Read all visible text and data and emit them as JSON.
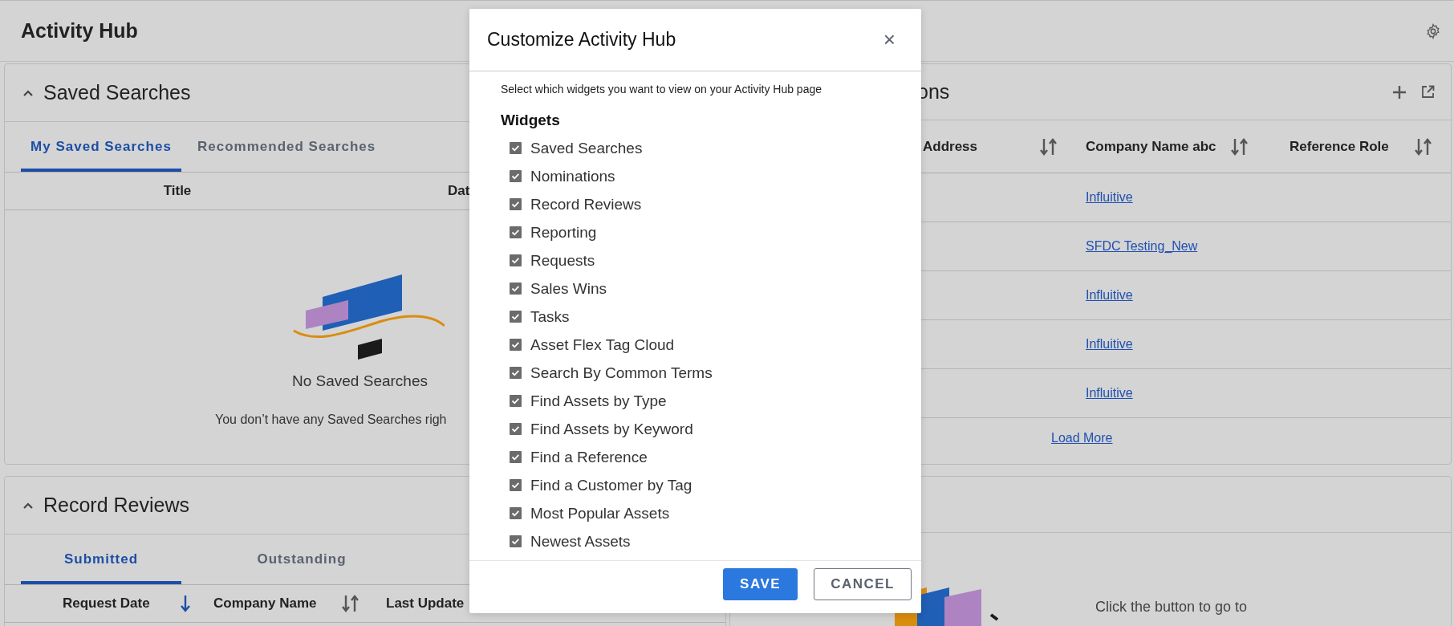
{
  "page": {
    "title": "Activity Hub"
  },
  "saved_searches": {
    "title": "Saved Searches",
    "expanded": true,
    "tabs": [
      {
        "label": "My Saved Searches",
        "selected": true
      },
      {
        "label": "Recommended Searches",
        "selected": false
      }
    ],
    "columns": [
      "Title",
      "Dat"
    ],
    "empty": {
      "title": "No Saved Searches",
      "text": "You don’t have any Saved Searches righ"
    }
  },
  "nominations": {
    "title": "ons",
    "columns": [
      {
        "label": "Address",
        "sorted": false
      },
      {
        "label": "Company Name abc",
        "sorted": false
      },
      {
        "label": "Reference Role",
        "sorted": false
      }
    ],
    "rows": [
      {
        "company": "Influitive"
      },
      {
        "company": "SFDC Testing_New"
      },
      {
        "company": "Influitive"
      },
      {
        "company": "Influitive"
      },
      {
        "company": "Influitive"
      }
    ],
    "load_more": "Load More"
  },
  "record_reviews": {
    "title": "Record Reviews",
    "expanded": true,
    "tabs": [
      {
        "label": "Submitted",
        "selected": true
      },
      {
        "label": "Outstanding",
        "selected": false
      }
    ],
    "columns": [
      {
        "label": "Request Date",
        "sorted": true
      },
      {
        "label": "Company Name",
        "sorted": false
      },
      {
        "label": "Last Update"
      }
    ]
  },
  "banner_card": {
    "text": "Click the button to go to"
  },
  "modal": {
    "title": "Customize Activity Hub",
    "close": "×",
    "intro": "Select which widgets you want to view on your Activity Hub page",
    "section": "Widgets",
    "widgets": [
      {
        "label": "Saved Searches",
        "checked": true
      },
      {
        "label": "Nominations",
        "checked": true
      },
      {
        "label": "Record Reviews",
        "checked": true
      },
      {
        "label": "Reporting",
        "checked": true
      },
      {
        "label": "Requests",
        "checked": true
      },
      {
        "label": "Sales Wins",
        "checked": true
      },
      {
        "label": "Tasks",
        "checked": true
      },
      {
        "label": "Asset Flex Tag Cloud",
        "checked": true
      },
      {
        "label": "Search By Common Terms",
        "checked": true
      },
      {
        "label": "Find Assets by Type",
        "checked": true
      },
      {
        "label": "Find Assets by Keyword",
        "checked": true
      },
      {
        "label": "Find a Reference",
        "checked": true
      },
      {
        "label": "Find a Customer by Tag",
        "checked": true
      },
      {
        "label": "Most Popular Assets",
        "checked": true
      },
      {
        "label": "Newest Assets",
        "checked": true
      }
    ],
    "buttons": [
      {
        "label": "SAVE",
        "kind": "primary"
      },
      {
        "label": "CANCEL",
        "kind": "secondary"
      }
    ]
  }
}
